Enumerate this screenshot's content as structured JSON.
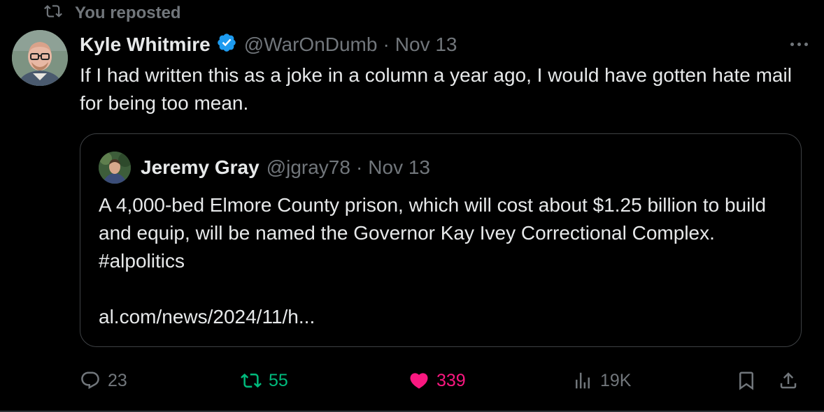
{
  "repost_banner": {
    "text": "You reposted",
    "icon": "repost-icon"
  },
  "tweet": {
    "author_name": "Kyle Whitmire",
    "verified": true,
    "handle": "@WarOnDumb",
    "separator": "·",
    "date": "Nov 13",
    "text": "If I had written this as a joke in a column a year ago, I would have gotten hate mail for being too mean."
  },
  "quoted_tweet": {
    "author_name": "Jeremy Gray",
    "handle": "@jgray78",
    "separator": "·",
    "date": "Nov 13",
    "text": "A 4,000-bed Elmore County prison, which will cost about $1.25 billion to build and equip, will be named the Governor Kay Ivey Correctional Complex. #alpolitics",
    "link": "al.com/news/2024/11/h..."
  },
  "actions": {
    "replies": "23",
    "reposts": "55",
    "likes": "339",
    "views": "19K"
  },
  "colors": {
    "background": "#000000",
    "text_primary": "#e7e9ea",
    "text_secondary": "#71767b",
    "verified_blue": "#1d9bf0",
    "repost_green": "#00ba7c",
    "like_pink": "#f91880",
    "border": "#3e4144"
  }
}
